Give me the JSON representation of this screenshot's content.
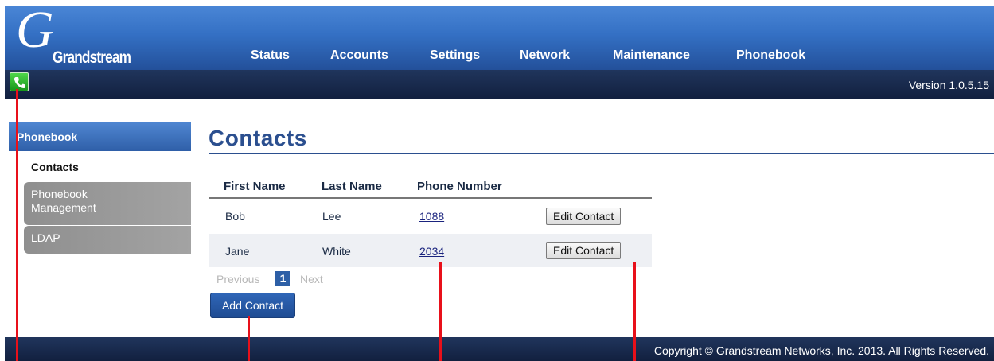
{
  "header": {
    "logo_text": "Grandstream",
    "nav": [
      {
        "label": "Status"
      },
      {
        "label": "Accounts"
      },
      {
        "label": "Settings"
      },
      {
        "label": "Network"
      },
      {
        "label": "Maintenance"
      },
      {
        "label": "Phonebook"
      }
    ]
  },
  "subbar": {
    "version": "Version 1.0.5.15",
    "phone_icon": "phone-icon"
  },
  "sidebar": {
    "section_title": "Phonebook",
    "active_item": "Contacts",
    "items": [
      {
        "label": "Phonebook Management"
      },
      {
        "label": "LDAP"
      }
    ]
  },
  "main": {
    "title": "Contacts",
    "columns": [
      "First Name",
      "Last Name",
      "Phone Number"
    ],
    "contacts": [
      {
        "first": "Bob",
        "last": "Lee",
        "phone": "1088",
        "action": "Edit Contact"
      },
      {
        "first": "Jane",
        "last": "White",
        "phone": "2034",
        "action": "Edit Contact"
      }
    ],
    "pager": {
      "previous": "Previous",
      "current": "1",
      "next": "Next"
    },
    "add_button": "Add Contact"
  },
  "footer": {
    "copyright": "Copyright © Grandstream Networks, Inc. 2013. All Rights Reserved."
  },
  "colors": {
    "brand_blue": "#3470c4",
    "dark_bar": "#12203f",
    "title_blue": "#2b4f8f",
    "annotation_red": "#e8101a"
  }
}
